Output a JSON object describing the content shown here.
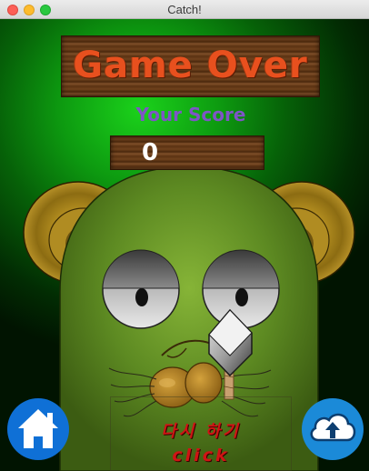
{
  "window": {
    "title": "Catch!"
  },
  "game": {
    "title": "Game Over",
    "score_label": "Your Score",
    "score": "0",
    "retry_line1": "다시 하기",
    "retry_line2": "click"
  },
  "icons": {
    "home": "home-icon",
    "upload": "cloud-upload-icon"
  },
  "colors": {
    "title_text": "#e8501e",
    "score_label": "#7e55c6",
    "retry_text": "#d01414",
    "background_center": "#1bd21b",
    "plank_wood": "#5b3212",
    "button_blue": "#0f70d6"
  }
}
